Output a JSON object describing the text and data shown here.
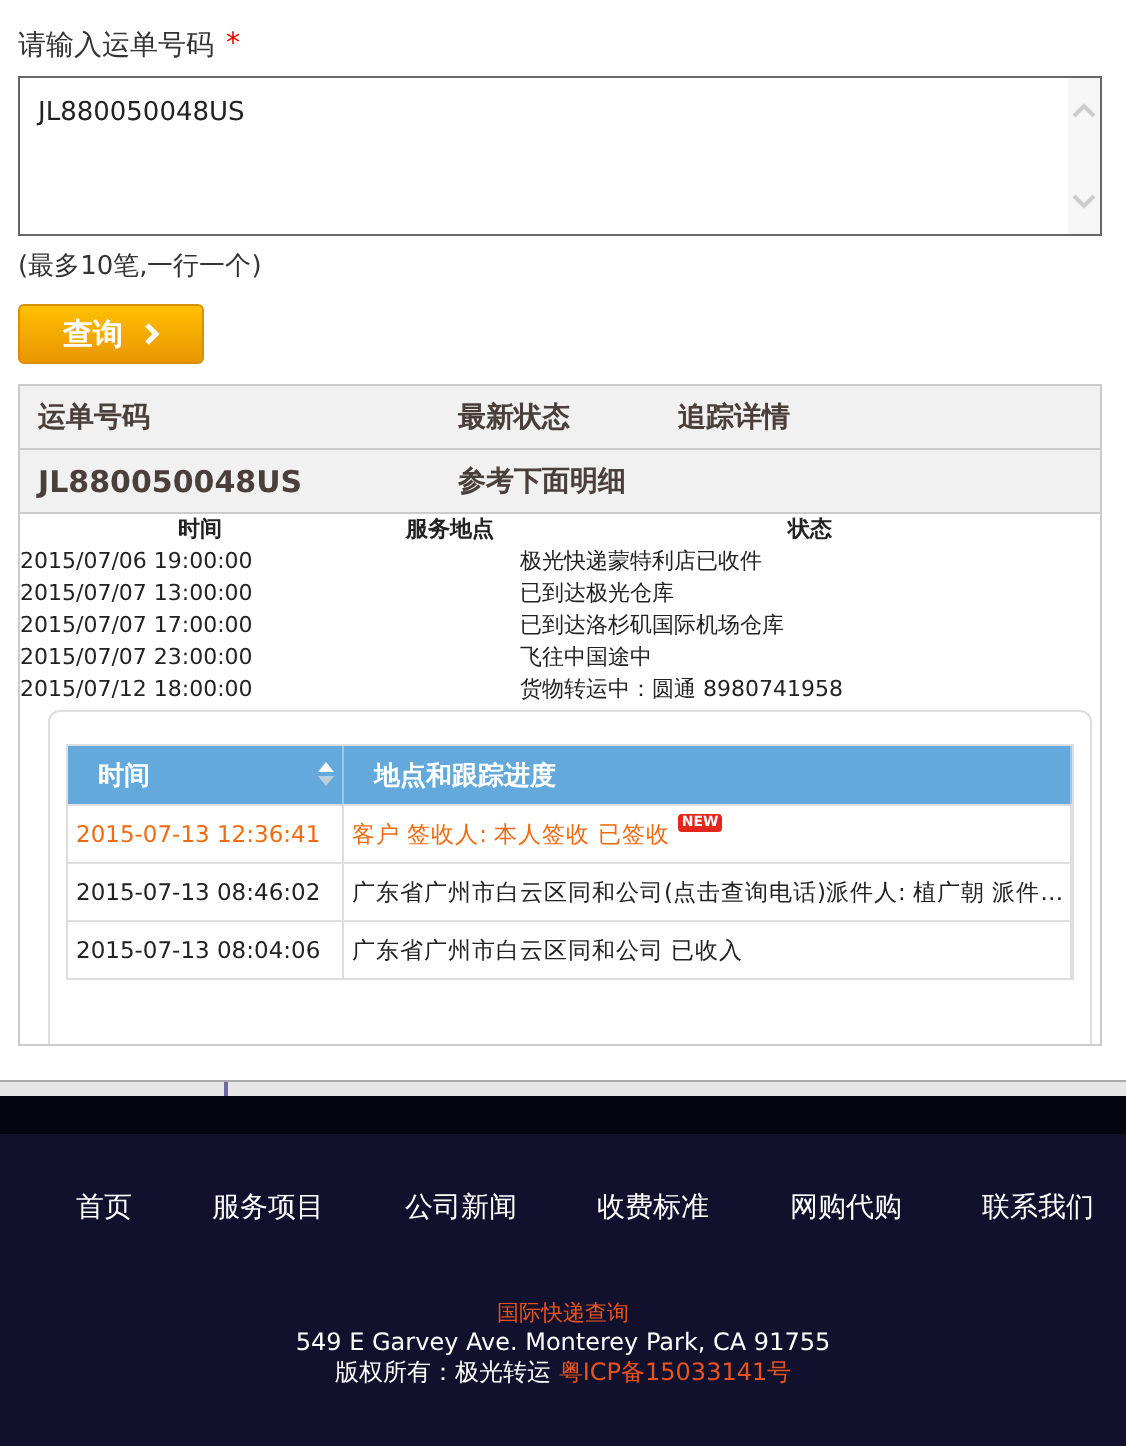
{
  "form": {
    "label": "请输入运单号码",
    "required_mark": "*",
    "value": "JL880050048US",
    "hint": "(最多10笔,一行一个)",
    "button": "查询"
  },
  "summary": {
    "columns": [
      "运单号码",
      "最新状态",
      "追踪详情"
    ],
    "row": {
      "number": "JL880050048US",
      "status": "参考下面明细"
    }
  },
  "history": {
    "columns": [
      "时间",
      "服务地点",
      "状态"
    ],
    "rows": [
      {
        "time": "2015/07/06 19:00:00",
        "status": "极光快递蒙特利店已收件"
      },
      {
        "time": "2015/07/07 13:00:00",
        "status": "已到达极光仓库"
      },
      {
        "time": "2015/07/07 17:00:00",
        "status": "已到达洛杉矶国际机场仓库"
      },
      {
        "time": "2015/07/07 23:00:00",
        "status": "飞往中国途中"
      },
      {
        "time": "2015/07/12 18:00:00",
        "status": "货物转运中：圆通 8980741958"
      }
    ]
  },
  "tracking": {
    "columns": [
      "时间",
      "地点和跟踪进度"
    ],
    "rows": [
      {
        "time": "2015-07-13 12:36:41",
        "detail": "客户 签收人: 本人签收 已签收",
        "latest": true,
        "badge": "NEW"
      },
      {
        "time": "2015-07-13 08:46:02",
        "detail": "广东省广州市白云区同和公司(点击查询电话)派件人: 植广朝 派件…",
        "latest": false
      },
      {
        "time": "2015-07-13 08:04:06",
        "detail": "广东省广州市白云区同和公司 已收入",
        "latest": false
      }
    ]
  },
  "footer": {
    "nav": [
      "首页",
      "服务项目",
      "公司新闻",
      "收费标准",
      "网购代购",
      "联系我们"
    ],
    "title": "国际快递查询",
    "address": "549 E Garvey Ave. Monterey Park, CA 91755",
    "copyright": "版权所有：极光转运",
    "icp": "粤ICP备15033141号"
  }
}
